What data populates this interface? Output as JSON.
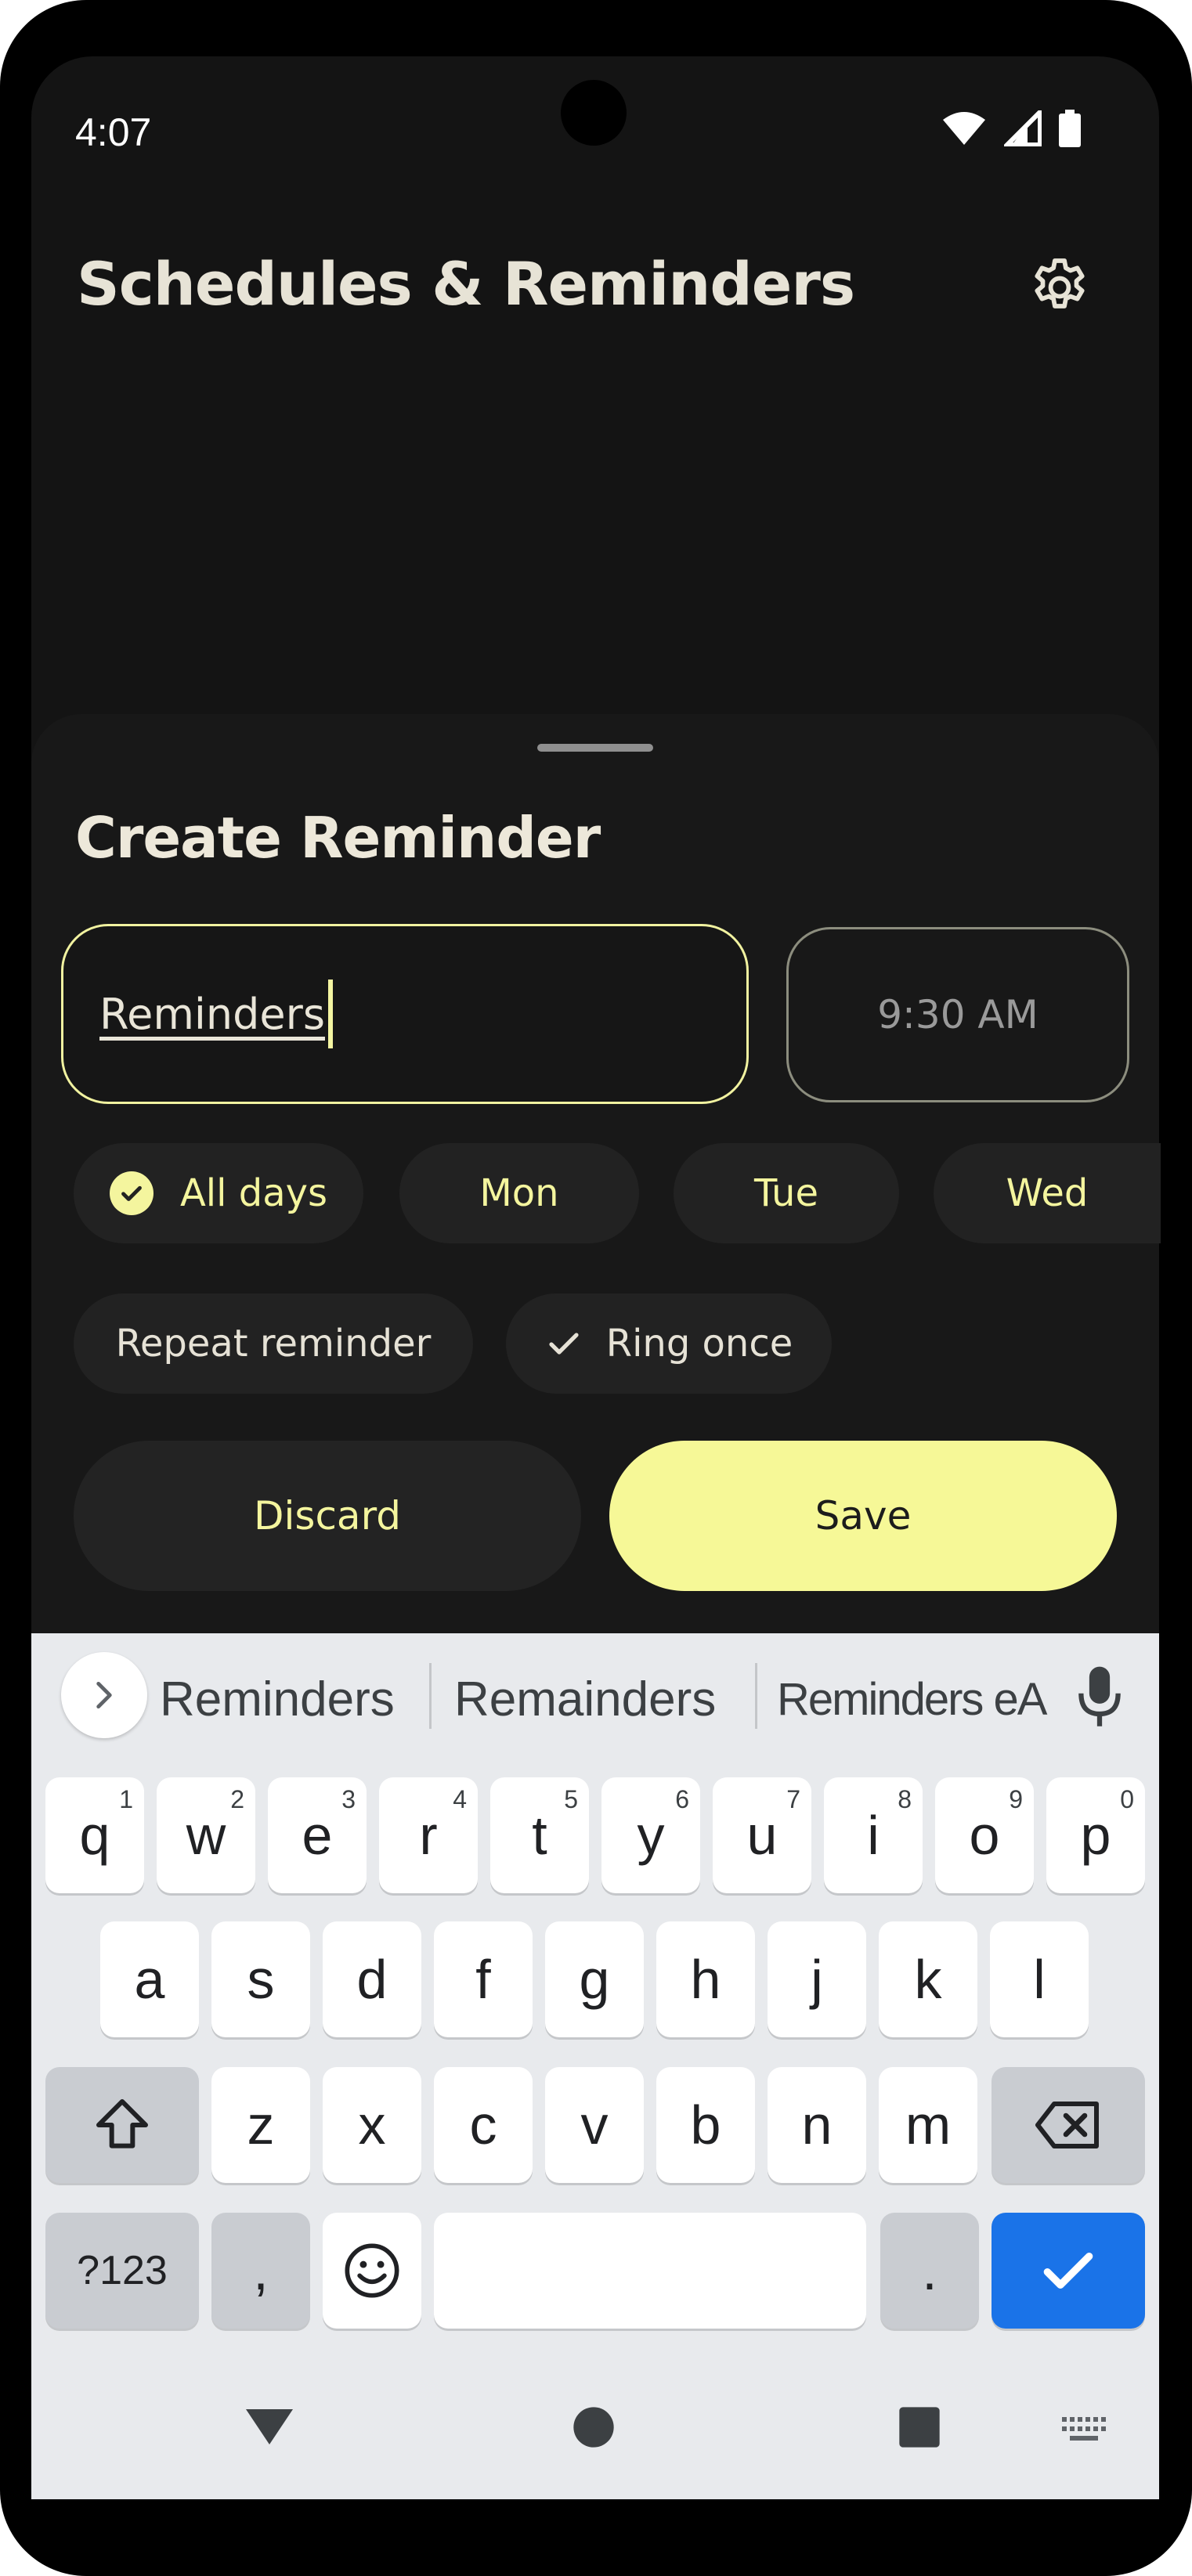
{
  "status_bar": {
    "time": "4:07"
  },
  "app_bar": {
    "title": "Schedules & Reminders",
    "settings_icon": "gear-icon"
  },
  "sheet": {
    "title": "Create Reminder",
    "name_field": {
      "value": "Reminders"
    },
    "time_field": {
      "value": "9:30 AM"
    },
    "day_chips": [
      {
        "label": "All days",
        "selected": true
      },
      {
        "label": "Mon",
        "selected": false
      },
      {
        "label": "Tue",
        "selected": false
      },
      {
        "label": "Wed",
        "selected": false
      }
    ],
    "option_chips": [
      {
        "label": "Repeat reminder",
        "selected": false
      },
      {
        "label": "Ring once",
        "selected": true
      }
    ],
    "discard_label": "Discard",
    "save_label": "Save"
  },
  "keyboard": {
    "suggestions": [
      "Reminders",
      "Remainders",
      "Reminders eA"
    ],
    "row1": [
      "q",
      "w",
      "e",
      "r",
      "t",
      "y",
      "u",
      "i",
      "o",
      "p"
    ],
    "row1_hints": [
      "1",
      "2",
      "3",
      "4",
      "5",
      "6",
      "7",
      "8",
      "9",
      "0"
    ],
    "row2": [
      "a",
      "s",
      "d",
      "f",
      "g",
      "h",
      "j",
      "k",
      "l"
    ],
    "row3": [
      "z",
      "x",
      "c",
      "v",
      "b",
      "n",
      "m"
    ],
    "symbols_label": "?123",
    "comma": ",",
    "period": "."
  },
  "colors": {
    "accent": "#f6f897",
    "background": "#141414",
    "chip": "#222222",
    "enter": "#1a73e8"
  }
}
